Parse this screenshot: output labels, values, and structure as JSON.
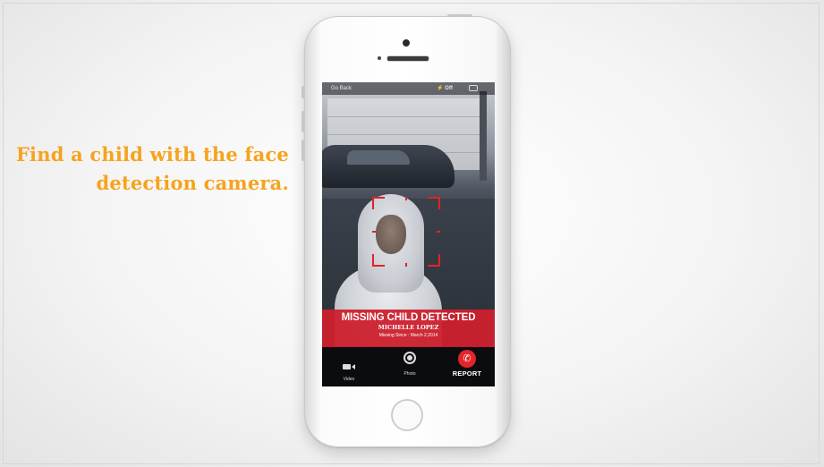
{
  "tagline": {
    "line1": "Find a child with the face",
    "line2": "detection camera."
  },
  "camera": {
    "go_back": "Go Back",
    "flash_icon": "lightning-icon",
    "flash_label": "Off",
    "flip_icon": "camera-flip-icon"
  },
  "alert": {
    "title": "MISSING CHILD DETECTED",
    "name": "MICHELLE LOPEZ",
    "missing_since": "Missing Since : March 2,2014"
  },
  "toolbar": {
    "video_label": "Video",
    "video_icon": "video-camera-icon",
    "photo_label": "Photo",
    "photo_icon": "shutter-icon",
    "report_label": "REPORT",
    "report_icon": "phone-icon"
  },
  "colors": {
    "tagline": "#f6a31c",
    "alert_banner": "#cd202d",
    "face_box": "#e02424",
    "report_button": "#e3242b"
  }
}
